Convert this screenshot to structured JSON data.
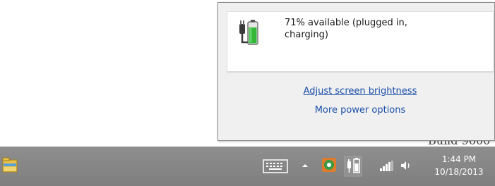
{
  "flyout": {
    "battery_status": "71% available (plugged in, charging)",
    "adjust_brightness_link": "Adjust screen brightness",
    "more_power_options_link": "More power options"
  },
  "desktop": {
    "partial_text": "Build 9600"
  },
  "taskbar": {
    "icons": {
      "explorer": "file-explorer-icon",
      "keyboard": "touch-keyboard-icon",
      "chevron": "chevron-up-icon",
      "app": "app-tray-icon",
      "power": "power-plug-icon",
      "network": "network-signal-icon",
      "volume": "speaker-icon"
    },
    "clock": {
      "time": "1:44 PM",
      "date": "10/18/2013"
    }
  },
  "colors": {
    "taskbar": "#858585",
    "link": "#1b4fa8",
    "flyout_bg": "#f0f0f0",
    "battery_fill": "#34b83a"
  }
}
